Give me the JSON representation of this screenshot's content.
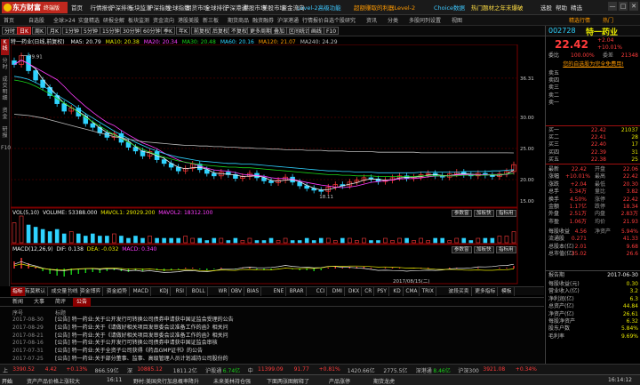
{
  "app": {
    "logo_text": "东方财富",
    "logo_sub": "终端版",
    "menus": [
      "首页",
      "行情报价",
      "沪深排行",
      "板块监测",
      "沪深指数",
      "全球指数",
      "期货市场",
      "全球排行",
      "沪深港通",
      "港股市场",
      "美股市场",
      "资金流向",
      "数据中心",
      "期权",
      "研报",
      "基金",
      "债券"
    ],
    "level2_label": "Level-2高级功能",
    "banner_text": "超额赚取的利器Level-2",
    "choice_label": "Choice数据",
    "hot_text": "热门题材之年末爆破",
    "right_links": [
      "选股",
      "帮助",
      "精选"
    ],
    "window_buttons": [
      "—",
      "□",
      "✕"
    ]
  },
  "nav2": {
    "items": [
      "首页",
      "自选股",
      "全球>24",
      "实盘精选",
      "研报全解",
      "板块监测",
      "资金流向",
      "港股美股",
      "新三板",
      "期货商品",
      "融资融券",
      "沪深港通",
      "行情报价",
      "自选个股",
      "研究",
      "资讯",
      "分类",
      "多股同列",
      "设置",
      "视图"
    ],
    "right_items": [
      "精选行情",
      "热门"
    ]
  },
  "toolbar": {
    "buttons": [
      "分时",
      "日K",
      "周K",
      "月K",
      "1分钟",
      "5分钟",
      "15分钟",
      "30分钟",
      "60分钟",
      "季K",
      "年K",
      "前复权",
      "后复权",
      "不复权",
      "更多周期",
      "叠加",
      "区间统计",
      "画线",
      "F10"
    ],
    "active_index": 1
  },
  "chart_title": {
    "stock": "特一药业(日线,前复权)",
    "ma": [
      {
        "label": "MA5: 20.79",
        "color": "#eeeeee"
      },
      {
        "label": "MA10: 20.38",
        "color": "#e6e600"
      },
      {
        "label": "MA20: 20.34",
        "color": "#ff3cff"
      },
      {
        "label": "MA30: 20.48",
        "color": "#19d219"
      },
      {
        "label": "MA60: 20.16",
        "color": "#2fd3ff"
      },
      {
        "label": "MA120: 21.07",
        "color": "#ff9a00"
      },
      {
        "label": "MA240: 24.29",
        "color": "#bbbbbb"
      }
    ]
  },
  "vtabs": [
    "K线",
    "分时",
    "成交明细",
    "资金",
    "研报",
    "F10"
  ],
  "chart_data": {
    "type": "line",
    "title": "特一药业(日线,前复权)",
    "y_labels": [
      "36.31",
      "30.00",
      "25.00",
      "20.00",
      "15.00"
    ],
    "ylim": [
      16,
      40
    ],
    "annotations": {
      "high": "39.91",
      "low": "18.11"
    },
    "close_series": [
      38.5,
      39.9,
      37.5,
      36.0,
      34.8,
      33.5,
      32.2,
      31.0,
      31.5,
      30.2,
      29.0,
      28.4,
      27.5,
      26.8,
      27.4,
      26.0,
      25.2,
      24.6,
      23.8,
      24.5,
      23.2,
      22.6,
      22.0,
      21.4,
      21.8,
      22.5,
      21.6,
      21.0,
      20.6,
      21.2,
      20.8,
      20.2,
      20.5,
      21.0,
      20.3,
      19.8,
      19.5,
      19.9,
      20.4,
      19.6,
      19.0,
      18.6,
      18.3,
      18.11,
      18.8,
      19.2,
      19.0,
      19.6,
      19.9,
      20.3,
      20.1,
      19.7,
      19.9,
      20.3,
      20.6,
      20.2,
      20.4,
      20.8,
      21.0,
      20.6,
      20.4,
      20.9,
      21.2,
      20.8,
      20.6,
      21.0,
      20.7,
      20.5,
      20.9,
      21.3,
      22.4
    ],
    "ma_long": [
      36.0,
      35.8,
      35.5,
      35.0,
      34.4,
      33.8,
      33.0,
      32.3,
      31.6,
      30.8,
      30.0,
      29.3,
      28.6,
      27.9,
      27.2,
      26.6,
      26.0,
      25.4,
      24.9,
      24.4,
      24.0,
      23.6,
      23.3,
      23.0,
      22.8,
      22.6,
      22.4,
      22.3,
      22.2,
      22.1,
      22.0,
      22.0,
      21.9,
      21.9,
      21.8,
      21.7,
      21.6,
      21.5,
      21.4,
      21.3,
      21.2,
      21.1,
      21.0,
      20.9,
      20.8,
      20.8,
      20.7,
      20.7,
      20.6,
      20.6,
      20.6,
      20.5,
      20.5,
      20.5,
      20.5,
      20.5,
      20.5,
      20.6,
      20.6,
      20.6,
      20.6,
      20.6,
      20.6,
      20.7,
      20.7,
      20.7,
      20.7,
      20.8,
      20.8,
      20.9,
      21.0
    ],
    "ma_240": [
      30.5,
      30.4,
      30.3,
      30.1,
      29.9,
      29.6,
      29.3,
      29.0,
      28.7,
      28.4,
      28.1,
      27.8,
      27.5,
      27.2,
      26.9,
      26.7,
      26.5,
      26.3,
      26.1,
      26.0,
      25.9,
      25.8,
      25.7,
      25.6,
      25.5,
      25.5,
      25.4,
      25.4,
      25.3,
      25.3,
      25.2,
      25.2,
      25.1,
      25.1,
      25.0,
      25.0,
      24.9,
      24.9,
      24.8,
      24.8,
      24.8,
      24.7,
      24.7,
      24.7,
      24.6,
      24.6,
      24.6,
      24.5,
      24.5,
      24.5,
      24.5,
      24.4,
      24.4,
      24.4,
      24.4,
      24.4,
      24.4,
      24.3,
      24.3,
      24.3,
      24.3,
      24.3,
      24.3,
      24.3,
      24.3,
      24.3,
      24.3,
      24.3,
      24.3,
      24.3,
      24.29
    ],
    "volume": [
      9,
      12,
      8,
      7,
      6,
      5,
      6,
      4,
      5,
      4,
      3,
      4,
      3,
      3,
      4,
      3,
      2,
      3,
      2,
      3,
      2,
      2,
      2,
      2,
      3,
      2,
      2,
      1,
      2,
      2,
      1,
      2,
      1,
      2,
      1,
      1,
      2,
      1,
      2,
      1,
      1,
      2,
      1,
      2,
      2,
      1,
      2,
      2,
      1,
      2,
      1,
      1,
      2,
      1,
      2,
      2,
      1,
      2,
      1,
      2,
      2,
      1,
      2,
      2,
      1,
      2,
      2,
      2,
      3,
      3,
      5
    ],
    "macd_hist": [
      0.8,
      1.2,
      0.6,
      0.2,
      -0.3,
      -0.6,
      -0.8,
      -0.9,
      -0.7,
      -0.6,
      -0.5,
      -0.4,
      -0.5,
      -0.3,
      -0.2,
      -0.3,
      -0.4,
      -0.2,
      -0.3,
      -0.1,
      -0.2,
      -0.3,
      -0.2,
      -0.1,
      0.1,
      0.1,
      -0.1,
      -0.2,
      -0.1,
      0.1,
      0.0,
      -0.1,
      0.1,
      0.1,
      -0.1,
      -0.2,
      -0.2,
      -0.1,
      0.1,
      -0.1,
      -0.2,
      -0.2,
      -0.3,
      -0.2,
      0.1,
      0.2,
      0.1,
      0.2,
      0.2,
      0.2,
      0.1,
      0.0,
      0.1,
      0.1,
      0.1,
      0.0,
      0.1,
      0.1,
      0.1,
      0.0,
      0.0,
      0.1,
      0.1,
      0.0,
      0.0,
      0.1,
      0.0,
      0.0,
      0.1,
      0.1,
      0.3
    ],
    "date_label": "2017/08/15(二)"
  },
  "vol_bar": {
    "label": "VOL(5,10)",
    "vol": "VOLUME: 53388.000",
    "mavol1": "MAVOL1: 29029.200",
    "mavol2": "MAVOL2: 18312.100",
    "buttons": [
      "参数窗",
      "加板快",
      "指标用"
    ]
  },
  "macd_bar": {
    "label": "MACD(12,26,9)",
    "dif": "DIF: 0.138",
    "dea": "DEA: -0.032",
    "macd": "MACD: 0.340",
    "buttons": [
      "参数窗",
      "加板快",
      "指标用"
    ]
  },
  "ind_tabs": [
    "指标",
    "有莫默认",
    "成交量",
    "均线",
    "资金博弈",
    "资金趋势",
    "MACD",
    "KDJ",
    "RSI",
    "BOLL",
    "WR",
    "OBV",
    "BIAS",
    "ENE",
    "BRAR",
    "CCI",
    "DMI",
    "DKX",
    "CR",
    "PSY",
    "KD",
    "CMA",
    "TRIX",
    "波段买卖",
    "更多指标",
    "模板"
  ],
  "news": {
    "tabs": [
      "新闻",
      "大事",
      "简评",
      "公告"
    ],
    "active_tab": 3,
    "header": [
      "序号",
      "标题"
    ],
    "rows": [
      {
        "date": "2017-08-30",
        "title": "[公告] 特一药业:关于公开发行可转换公司债券申请获中国证监会受理的公告"
      },
      {
        "date": "2017-08-29",
        "title": "[公告] 特一药业:关于《请做好相关项目发审委会议准备工作的函》相关问"
      },
      {
        "date": "2017-08-21",
        "title": "[公告] 特一药业:关于《请做好相关项目发审委会议准备工作的函》相关问"
      },
      {
        "date": "2017-08-16",
        "title": "[公告] 特一药业:关于公开发行可转换公司债券申请获中国证监会审核"
      },
      {
        "date": "2017-07-31",
        "title": "[公告] 特一药业:关于全资子公司获得《药品GMP证书》的公告"
      },
      {
        "date": "2017-07-25",
        "title": "[公告] 特一药业:关于部分董事、监事、高级管理人员计划减持公司股份的"
      }
    ]
  },
  "quote": {
    "code": "002728",
    "name": "特一药业",
    "price": "22.42",
    "change": "+2.04",
    "pct": "+10.01%",
    "webi_label": "委比",
    "webi": "100.00%",
    "wecha_label": "委差",
    "wecha": "21348",
    "notice": "您的自选股为完全免费用!",
    "asks": [
      {
        "l": "卖五",
        "p": "",
        "v": ""
      },
      {
        "l": "卖四",
        "p": "",
        "v": ""
      },
      {
        "l": "卖三",
        "p": "",
        "v": ""
      },
      {
        "l": "卖二",
        "p": "",
        "v": ""
      },
      {
        "l": "卖一",
        "p": "",
        "v": ""
      }
    ],
    "bids": [
      {
        "l": "买一",
        "p": "22.42",
        "v": "21037"
      },
      {
        "l": "买二",
        "p": "22.41",
        "v": "28"
      },
      {
        "l": "买三",
        "p": "22.40",
        "v": "17"
      },
      {
        "l": "买四",
        "p": "22.39",
        "v": "31"
      },
      {
        "l": "买五",
        "p": "22.38",
        "v": "25"
      }
    ],
    "stats": [
      {
        "l": "最新",
        "v": "22.42",
        "l2": "开盘",
        "v2": "22.06"
      },
      {
        "l": "涨幅",
        "v": "+10.01%",
        "l2": "最高",
        "v2": "22.42"
      },
      {
        "l": "涨跌",
        "v": "+2.04",
        "l2": "最低",
        "v2": "20.30"
      },
      {
        "l": "总手",
        "v": "5.34万",
        "l2": "量比",
        "v2": "3.82"
      },
      {
        "l": "换手",
        "v": "4.50%",
        "l2": "涨停",
        "v2": "22.42"
      },
      {
        "l": "金额",
        "v": "1.17亿",
        "l2": "跌停",
        "v2": "18.34"
      },
      {
        "l": "外盘",
        "v": "2.51万",
        "l2": "内盘",
        "v2": "2.83万"
      },
      {
        "l": "市盈",
        "v": "1.06万",
        "l2": "均价",
        "v2": "21.93"
      }
    ],
    "fin": [
      {
        "l": "每股收益",
        "v": "4.56",
        "l2": "净资产",
        "v2": "5.94%"
      },
      {
        "l": "流通股",
        "v": "0.271",
        "l2": "",
        "v2": "41.33"
      },
      {
        "l": "总股本(亿)",
        "v": "2.01",
        "l2": "",
        "v2": "9.68"
      },
      {
        "l": "总市值(亿)",
        "v": "35.02",
        "l2": "",
        "v2": "26.6"
      }
    ],
    "report_label": "报告期",
    "report_date": "2017-06-30",
    "report_rows": [
      {
        "l": "每股收益(元)",
        "v": "0.30"
      },
      {
        "l": "营业收入(亿)",
        "v": "3.2"
      },
      {
        "l": "净利润(亿)",
        "v": "6.3"
      },
      {
        "l": "总资产(亿)",
        "v": "44.84"
      },
      {
        "l": "净资产(亿)",
        "v": "26.61"
      },
      {
        "l": "每股净资产",
        "v": "6.32"
      },
      {
        "l": "股东户数",
        "v": "5.84%"
      },
      {
        "l": "毛利率",
        "v": "9.69%"
      }
    ]
  },
  "status": {
    "items": [
      {
        "t": "上",
        "c": "#bbbbbb"
      },
      {
        "t": "3390.52",
        "c": "#ff3b3b"
      },
      {
        "t": "4.42",
        "c": "#ff3b3b"
      },
      {
        "t": "+0.13%",
        "c": "#ff3b3b"
      },
      {
        "t": "866.59亿",
        "c": "#bbbbbb"
      },
      {
        "t": "深",
        "c": "#bbbbbb"
      },
      {
        "t": "10885.12",
        "c": "#ff3b3b"
      },
      {
        "t": "1811.2亿",
        "c": "#bbbbbb"
      },
      {
        "t": "沪股通",
        "c": "#bbbbbb"
      },
      {
        "t": "6.74亿",
        "c": "#19d219"
      },
      {
        "t": "中",
        "c": "#bbbbbb"
      },
      {
        "t": "11399.09",
        "c": "#ff3b3b"
      },
      {
        "t": "91.77",
        "c": "#ff3b3b"
      },
      {
        "t": "+0.81%",
        "c": "#ff3b3b"
      },
      {
        "t": "1420.66亿",
        "c": "#bbbbbb"
      },
      {
        "t": "2775.5亿",
        "c": "#bbbbbb"
      },
      {
        "t": "深港通",
        "c": "#bbbbbb"
      },
      {
        "t": "8.46亿",
        "c": "#19d219"
      },
      {
        "t": "沪深300",
        "c": "#bbbbbb"
      },
      {
        "t": "3921.08",
        "c": "#ff3b3b"
      },
      {
        "t": "+0.34%",
        "c": "#ff3b3b"
      }
    ]
  },
  "taskbar": {
    "items": [
      "开始",
      "资产产品价格上涨较大",
      "16:11",
      "野村:美国央行加息概率降升",
      "未来美林持仓强",
      "下面两张图解释了",
      "产品涨停",
      "期货龙虎",
      "16:14:12"
    ]
  }
}
